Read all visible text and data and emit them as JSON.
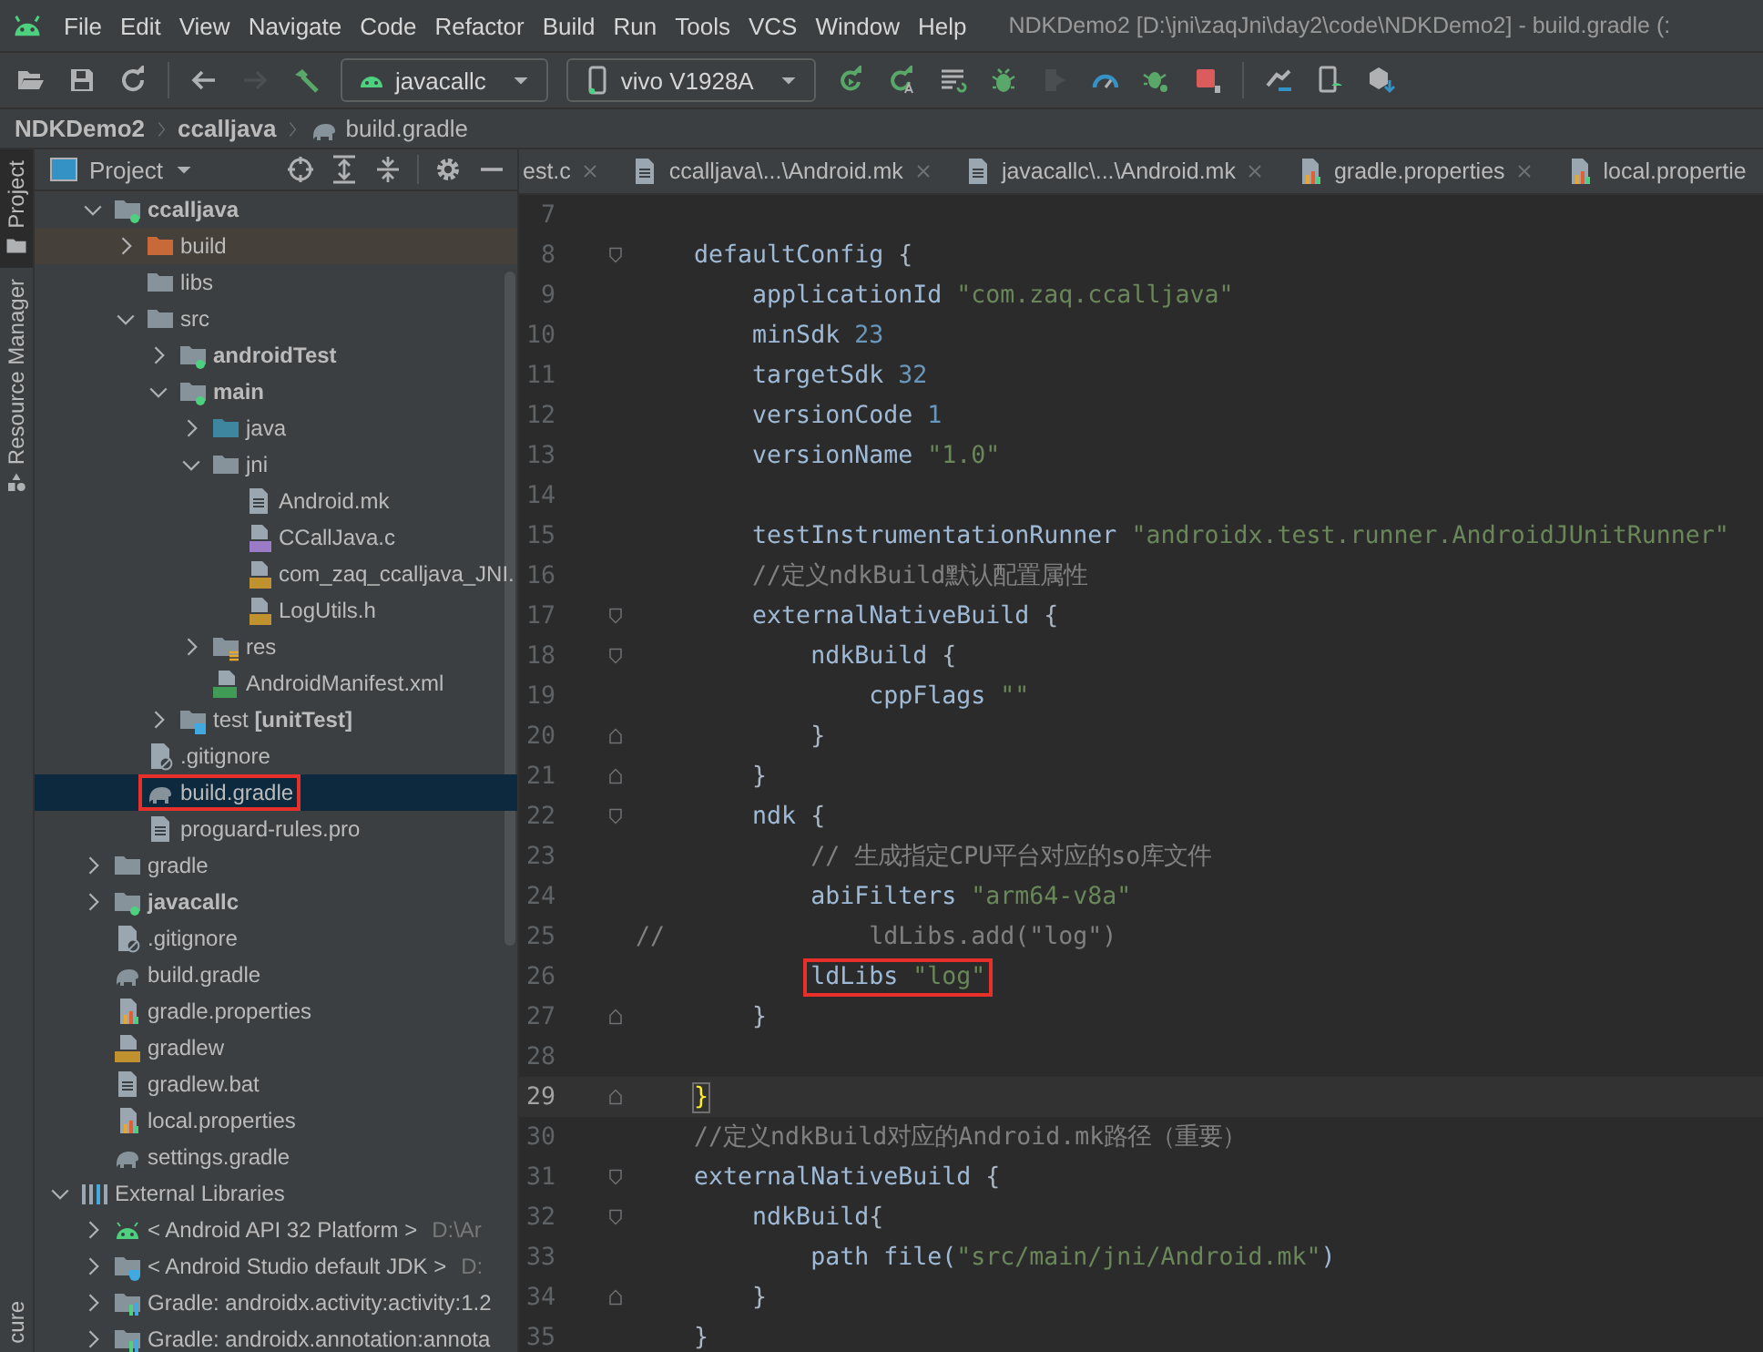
{
  "menu": [
    "File",
    "Edit",
    "View",
    "Navigate",
    "Code",
    "Refactor",
    "Build",
    "Run",
    "Tools",
    "VCS",
    "Window",
    "Help"
  ],
  "window": {
    "title": "NDKDemo2 [D:\\jni\\zaqJni\\day2\\code\\NDKDemo2] - build.gradle (:"
  },
  "toolbar": [
    {
      "kind": "open",
      "disabled": false
    },
    {
      "kind": "save",
      "disabled": false
    },
    {
      "kind": "sync",
      "disabled": false
    },
    {
      "kind": "sep"
    },
    {
      "kind": "back",
      "disabled": false
    },
    {
      "kind": "forward",
      "disabled": true
    },
    {
      "kind": "hammer",
      "disabled": false
    },
    {
      "kind": "config",
      "label": "javacallc",
      "disabled": false
    },
    {
      "kind": "device",
      "label": "vivo V1928A",
      "disabled": false
    },
    {
      "kind": "rerun",
      "disabled": false
    },
    {
      "kind": "apply-code",
      "disabled": false
    },
    {
      "kind": "apply-changes",
      "disabled": false
    },
    {
      "kind": "debug",
      "disabled": false
    },
    {
      "kind": "attach",
      "disabled": true
    },
    {
      "kind": "profile",
      "disabled": false
    },
    {
      "kind": "bug-gear",
      "disabled": false
    },
    {
      "kind": "stop",
      "disabled": false
    },
    {
      "kind": "sep"
    },
    {
      "kind": "device-manager",
      "disabled": false
    },
    {
      "kind": "avd",
      "disabled": false
    },
    {
      "kind": "sdk",
      "disabled": false
    }
  ],
  "breadcrumb": [
    {
      "label": "NDKDemo2",
      "kind": "module"
    },
    {
      "label": "ccalljava",
      "kind": "module"
    },
    {
      "label": "build.gradle",
      "kind": "gradle"
    }
  ],
  "side_tabs": [
    {
      "label": "Project",
      "selected": true,
      "kind": "folder"
    },
    {
      "label": "Resource Manager",
      "selected": false,
      "kind": "shapes"
    },
    {
      "label": "cure",
      "selected": false,
      "kind": "plain"
    }
  ],
  "project_panel": {
    "title": "Project",
    "tree": [
      {
        "kind": "scrolled",
        "children": [
          {
            "label": "ccalljava",
            "kind": "module",
            "expanded": true,
            "selected": false,
            "children": [
              {
                "label": "build",
                "kind": "excluded",
                "expanded": false,
                "selected": false
              },
              {
                "label": "libs",
                "kind": "folder",
                "selected": false
              },
              {
                "label": "src",
                "kind": "folder",
                "expanded": true,
                "selected": false,
                "children": [
                  {
                    "label": "androidTest",
                    "kind": "module",
                    "expanded": false,
                    "selected": false
                  },
                  {
                    "label": "main",
                    "kind": "module",
                    "expanded": true,
                    "selected": false,
                    "children": [
                      {
                        "label": "java",
                        "kind": "source",
                        "expanded": false,
                        "selected": false
                      },
                      {
                        "label": "jni",
                        "kind": "folder",
                        "expanded": true,
                        "selected": false,
                        "children": [
                          {
                            "label": "Android.mk",
                            "kind": "file",
                            "selected": false
                          },
                          {
                            "label": "CCallJava.c",
                            "kind": "c-file",
                            "selected": false
                          },
                          {
                            "label": "com_zaq_ccalljava_JNI.",
                            "kind": "h-file",
                            "selected": false
                          },
                          {
                            "label": "LogUtils.h",
                            "kind": "h-file",
                            "selected": false
                          }
                        ]
                      },
                      {
                        "label": "res",
                        "kind": "res",
                        "expanded": false,
                        "selected": false
                      },
                      {
                        "label": "AndroidManifest.xml",
                        "kind": "manifest",
                        "selected": false
                      }
                    ]
                  },
                  {
                    "label": "test **[unitTest]**",
                    "kind": "test",
                    "expanded": false,
                    "selected": false
                  }
                ]
              },
              {
                "label": ".gitignore",
                "kind": "gitignore",
                "selected": false
              },
              {
                "label": "build.gradle",
                "kind": "gradle",
                "selected": true,
                "marked": true
              },
              {
                "label": "proguard-rules.pro",
                "kind": "file",
                "selected": false
              }
            ]
          },
          {
            "label": "gradle",
            "kind": "folder",
            "expanded": false,
            "selected": false
          },
          {
            "label": "javacallc",
            "kind": "module",
            "expanded": false,
            "selected": false
          },
          {
            "label": ".gitignore",
            "kind": "gitignore",
            "selected": false
          },
          {
            "label": "build.gradle",
            "kind": "gradle",
            "selected": false
          },
          {
            "label": "gradle.properties",
            "kind": "properties",
            "selected": false
          },
          {
            "label": "gradlew",
            "kind": "shell",
            "selected": false
          },
          {
            "label": "gradlew.bat",
            "kind": "file",
            "selected": false
          },
          {
            "label": "local.properties",
            "kind": "properties",
            "selected": false
          },
          {
            "label": "settings.gradle",
            "kind": "gradle",
            "selected": false
          }
        ]
      },
      {
        "label": "External Libraries",
        "kind": "libraries",
        "expanded": true,
        "selected": false,
        "children": [
          {
            "label": "< Android API 32 Platform >",
            "hint": "D:\\Ar",
            "kind": "android",
            "expanded": false,
            "selected": false
          },
          {
            "label": "< Android Studio default JDK >",
            "hint": "D:",
            "kind": "jdk",
            "expanded": false,
            "selected": false
          },
          {
            "label": "Gradle: androidx.activity:activity:1.2",
            "kind": "library",
            "expanded": false,
            "selected": false
          },
          {
            "label": "Gradle: androidx.annotation:annota",
            "kind": "library",
            "expanded": false,
            "selected": false
          }
        ]
      }
    ]
  },
  "editor": {
    "tabs": [
      {
        "label": "est.c",
        "kind": "plain",
        "selected": false
      },
      {
        "label": "ccalljava\\...\\Android.mk",
        "kind": "file",
        "selected": false
      },
      {
        "label": "javacallc\\...\\Android.mk",
        "kind": "file",
        "selected": false
      },
      {
        "label": "gradle.properties",
        "kind": "properties",
        "selected": false
      },
      {
        "label": "local.propertie",
        "kind": "properties",
        "selected": false
      }
    ],
    "lines": [
      {
        "no": "7",
        "kind": "plain"
      },
      {
        "no": "8",
        "kind": "fold-start",
        "tokens": [
          {
            "kind": "ident",
            "text": "    defaultConfig "
          },
          {
            "kind": "brace",
            "text": "{"
          }
        ]
      },
      {
        "no": "9",
        "kind": "plain",
        "tokens": [
          {
            "kind": "ident",
            "text": "        applicationId "
          },
          {
            "kind": "str",
            "text": "\"com.zaq.ccalljava\""
          }
        ]
      },
      {
        "no": "10",
        "kind": "plain",
        "tokens": [
          {
            "kind": "ident",
            "text": "        minSdk "
          },
          {
            "kind": "num",
            "text": "23"
          }
        ]
      },
      {
        "no": "11",
        "kind": "plain",
        "tokens": [
          {
            "kind": "ident",
            "text": "        targetSdk "
          },
          {
            "kind": "num",
            "text": "32"
          }
        ]
      },
      {
        "no": "12",
        "kind": "plain",
        "tokens": [
          {
            "kind": "ident",
            "text": "        versionCode "
          },
          {
            "kind": "num",
            "text": "1"
          }
        ]
      },
      {
        "no": "13",
        "kind": "plain",
        "tokens": [
          {
            "kind": "ident",
            "text": "        versionName "
          },
          {
            "kind": "str",
            "text": "\"1.0\""
          }
        ]
      },
      {
        "no": "14",
        "kind": "plain"
      },
      {
        "no": "15",
        "kind": "plain",
        "tokens": [
          {
            "kind": "ident",
            "text": "        testInstrumentationRunner "
          },
          {
            "kind": "str",
            "text": "\"androidx.test.runner.AndroidJUnitRunner\""
          }
        ]
      },
      {
        "no": "16",
        "kind": "plain",
        "tokens": [
          {
            "kind": "com",
            "text": "        //定义ndkBuild默认配置属性"
          }
        ]
      },
      {
        "no": "17",
        "kind": "fold-start",
        "tokens": [
          {
            "kind": "ident",
            "text": "        externalNativeBuild "
          },
          {
            "kind": "brace",
            "text": "{"
          }
        ]
      },
      {
        "no": "18",
        "kind": "fold-start",
        "tokens": [
          {
            "kind": "ident",
            "text": "            ndkBuild "
          },
          {
            "kind": "brace",
            "text": "{"
          }
        ]
      },
      {
        "no": "19",
        "kind": "plain",
        "tokens": [
          {
            "kind": "ident",
            "text": "                cppFlags "
          },
          {
            "kind": "str",
            "text": "\"\""
          }
        ]
      },
      {
        "no": "20",
        "kind": "fold-end",
        "tokens": [
          {
            "kind": "brace",
            "text": "            }"
          }
        ]
      },
      {
        "no": "21",
        "kind": "fold-end",
        "tokens": [
          {
            "kind": "brace",
            "text": "        }"
          }
        ]
      },
      {
        "no": "22",
        "kind": "fold-start",
        "tokens": [
          {
            "kind": "ident",
            "text": "        ndk "
          },
          {
            "kind": "brace",
            "text": "{"
          }
        ]
      },
      {
        "no": "23",
        "kind": "plain",
        "tokens": [
          {
            "kind": "com",
            "text": "            // 生成指定CPU平台对应的so库文件"
          }
        ]
      },
      {
        "no": "24",
        "kind": "plain",
        "tokens": [
          {
            "kind": "ident",
            "text": "            abiFilters "
          },
          {
            "kind": "str",
            "text": "\"arm64-v8a\""
          }
        ]
      },
      {
        "no": "25",
        "kind": "plain",
        "tokens": [
          {
            "kind": "com",
            "text": "//              ldLibs.add(\"log\")"
          }
        ]
      },
      {
        "no": "26",
        "kind": "plain",
        "tokens": [
          {
            "kind": "box",
            "children": [
              {
                "kind": "ident",
                "text": "ldLibs "
              },
              {
                "kind": "str",
                "text": "\"log\""
              }
            ]
          }
        ]
      },
      {
        "no": "27",
        "kind": "fold-end",
        "tokens": [
          {
            "kind": "brace",
            "text": "        }"
          }
        ]
      },
      {
        "no": "28",
        "kind": "plain"
      },
      {
        "no": "29",
        "kind": "fold-end",
        "current": true,
        "tokens": [
          {
            "kind": "match",
            "text": "}"
          }
        ]
      },
      {
        "no": "30",
        "kind": "plain",
        "tokens": [
          {
            "kind": "com",
            "text": "    //定义ndkBuild对应的Android.mk路径（重要）"
          }
        ]
      },
      {
        "no": "31",
        "kind": "fold-start",
        "tokens": [
          {
            "kind": "ident",
            "text": "    externalNativeBuild "
          },
          {
            "kind": "brace",
            "text": "{"
          }
        ]
      },
      {
        "no": "32",
        "kind": "fold-start",
        "tokens": [
          {
            "kind": "ident",
            "text": "        ndkBuild"
          },
          {
            "kind": "brace",
            "text": "{"
          }
        ]
      },
      {
        "no": "33",
        "kind": "plain",
        "tokens": [
          {
            "kind": "ident",
            "text": "            path file("
          },
          {
            "kind": "str",
            "text": "\"src/main/jni/Android.mk\""
          },
          {
            "kind": "ident",
            "text": ")"
          }
        ]
      },
      {
        "no": "34",
        "kind": "fold-end",
        "tokens": [
          {
            "kind": "brace",
            "text": "        }"
          }
        ]
      },
      {
        "no": "35",
        "kind": "plain",
        "tokens": [
          {
            "kind": "brace",
            "text": "    }"
          }
        ]
      }
    ]
  }
}
